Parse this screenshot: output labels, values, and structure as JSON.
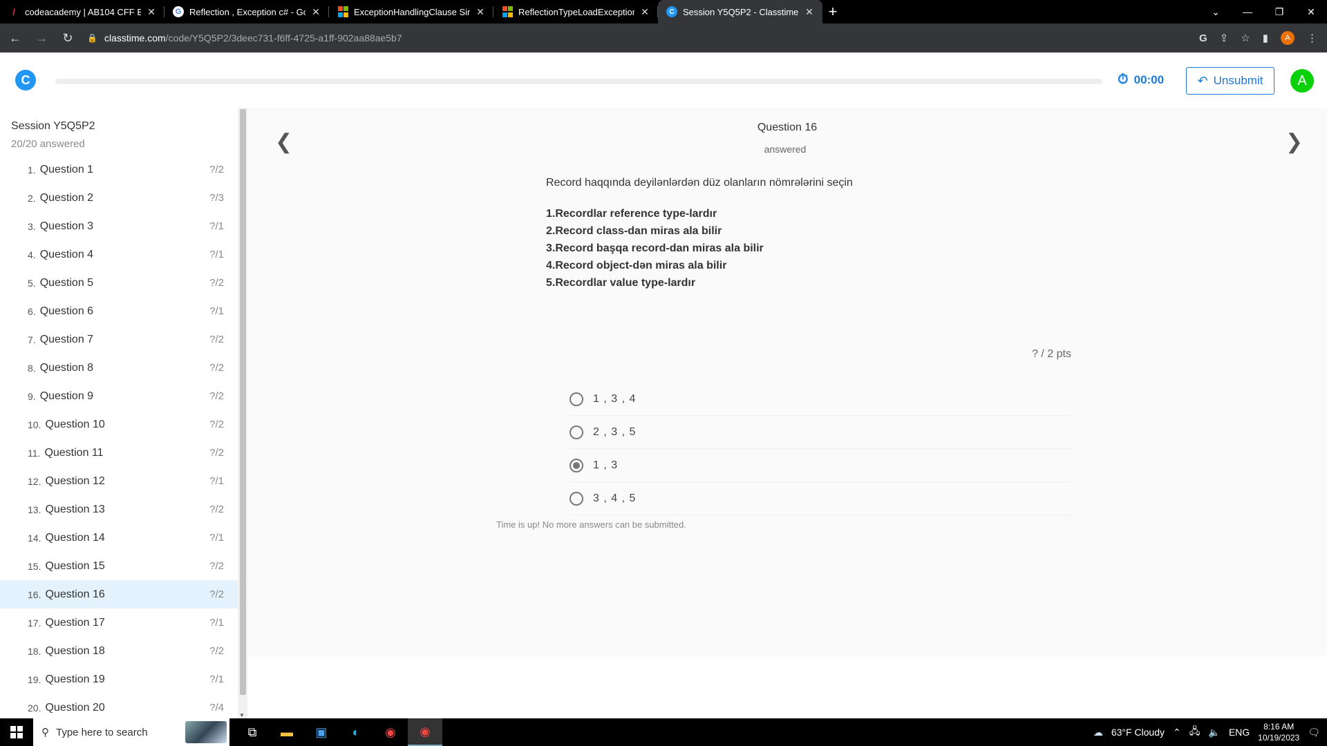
{
  "browser": {
    "tabs": [
      {
        "title": "codeacademy | AB104 CFF Backe",
        "icon": "codeacademy-icon"
      },
      {
        "title": "Reflection , Exception c# - Goog",
        "icon": "google-icon"
      },
      {
        "title": "ExceptionHandlingClause Sinfi (S",
        "icon": "microsoft-icon"
      },
      {
        "title": "ReflectionTypeLoadException Sin",
        "icon": "microsoft-icon"
      },
      {
        "title": "Session Y5Q5P2 - Classtime",
        "icon": "classtime-icon",
        "active": true
      }
    ],
    "url_host": "classtime.com",
    "url_path": "/code/Y5Q5P2/3deec731-f6ff-4725-a1ff-902aa88ae5b7",
    "profile_initial": "A"
  },
  "header": {
    "timer": "00:00",
    "unsubmit_label": "Unsubmit",
    "user_initial": "A",
    "accent": "#1a7ad8",
    "user_color": "#0bd10b"
  },
  "sidebar": {
    "session": "Session Y5Q5P2",
    "answered": "20/20 answered",
    "questions": [
      {
        "num": "1.",
        "label": "Question 1",
        "score": "?/2"
      },
      {
        "num": "2.",
        "label": "Question 2",
        "score": "?/3"
      },
      {
        "num": "3.",
        "label": "Question 3",
        "score": "?/1"
      },
      {
        "num": "4.",
        "label": "Question 4",
        "score": "?/1"
      },
      {
        "num": "5.",
        "label": "Question 5",
        "score": "?/2"
      },
      {
        "num": "6.",
        "label": "Question 6",
        "score": "?/1"
      },
      {
        "num": "7.",
        "label": "Question 7",
        "score": "?/2"
      },
      {
        "num": "8.",
        "label": "Question 8",
        "score": "?/2"
      },
      {
        "num": "9.",
        "label": "Question 9",
        "score": "?/2"
      },
      {
        "num": "10.",
        "label": "Question 10",
        "score": "?/2"
      },
      {
        "num": "11.",
        "label": "Question 11",
        "score": "?/2"
      },
      {
        "num": "12.",
        "label": "Question 12",
        "score": "?/1"
      },
      {
        "num": "13.",
        "label": "Question 13",
        "score": "?/2"
      },
      {
        "num": "14.",
        "label": "Question 14",
        "score": "?/1"
      },
      {
        "num": "15.",
        "label": "Question 15",
        "score": "?/2"
      },
      {
        "num": "16.",
        "label": "Question 16",
        "score": "?/2",
        "selected": true
      },
      {
        "num": "17.",
        "label": "Question 17",
        "score": "?/1"
      },
      {
        "num": "18.",
        "label": "Question 18",
        "score": "?/2"
      },
      {
        "num": "19.",
        "label": "Question 19",
        "score": "?/1"
      },
      {
        "num": "20.",
        "label": "Question 20",
        "score": "?/4"
      }
    ]
  },
  "question": {
    "title": "Question 16",
    "status": "answered",
    "prompt": "Record haqqında deyilənlərdən düz olanların nömrələrini seçin",
    "statements": [
      "1.Recordlar reference type-lardır",
      "2.Record class-dan miras ala bilir",
      "3.Record başqa record-dan miras ala bilir",
      "4.Record object-dən miras ala bilir",
      "5.Recordlar value type-lardır"
    ],
    "points": "? / 2 pts",
    "options": [
      {
        "label": "1 , 3 , 4",
        "selected": false
      },
      {
        "label": "2 , 3 , 5",
        "selected": false
      },
      {
        "label": "1 , 3",
        "selected": true
      },
      {
        "label": "3 , 4 , 5",
        "selected": false
      }
    ],
    "notice": "Time is up! No more answers can be submitted."
  },
  "taskbar": {
    "search_placeholder": "Type here to search",
    "weather": "63°F  Cloudy",
    "lang": "ENG",
    "time": "8:16 AM",
    "date": "10/19/2023"
  }
}
